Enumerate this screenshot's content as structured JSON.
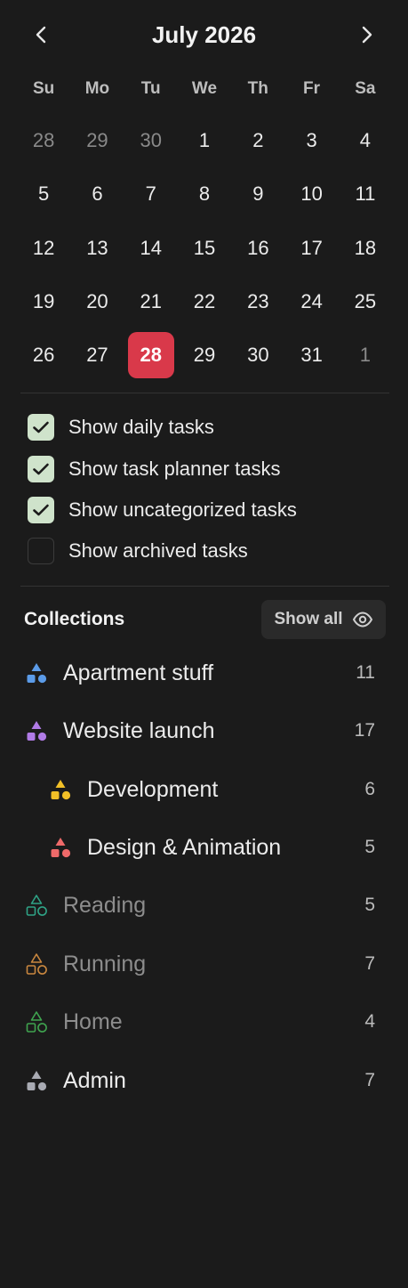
{
  "calendar": {
    "month_title": "July 2026",
    "weekdays": [
      "Su",
      "Mo",
      "Tu",
      "We",
      "Th",
      "Fr",
      "Sa"
    ],
    "weeks": [
      [
        "28",
        "29",
        "30",
        "1",
        "2",
        "3",
        "4"
      ],
      [
        "5",
        "6",
        "7",
        "8",
        "9",
        "10",
        "11"
      ],
      [
        "12",
        "13",
        "14",
        "15",
        "16",
        "17",
        "18"
      ],
      [
        "19",
        "20",
        "21",
        "22",
        "23",
        "24",
        "25"
      ],
      [
        "26",
        "27",
        "28",
        "29",
        "30",
        "31",
        "1"
      ]
    ],
    "today": "28",
    "accent_color": "#d9394a"
  },
  "options": [
    {
      "label": "Show daily tasks",
      "checked": true
    },
    {
      "label": "Show task planner tasks",
      "checked": true
    },
    {
      "label": "Show uncategorized tasks",
      "checked": true
    },
    {
      "label": "Show archived tasks",
      "checked": false
    }
  ],
  "collections": {
    "title": "Collections",
    "show_all_label": "Show all",
    "items": [
      {
        "name": "Apartment stuff",
        "count": "11",
        "color": "#5b9be8",
        "indent": false,
        "style": "filled"
      },
      {
        "name": "Website launch",
        "count": "17",
        "color": "#b07be6",
        "indent": false,
        "style": "filled"
      },
      {
        "name": "Development",
        "count": "6",
        "color": "#f2c027",
        "indent": true,
        "style": "filled"
      },
      {
        "name": "Design & Animation",
        "count": "5",
        "color": "#ef6a6a",
        "indent": true,
        "style": "filled"
      },
      {
        "name": "Reading",
        "count": "5",
        "color": "#2fa386",
        "indent": false,
        "style": "outline"
      },
      {
        "name": "Running",
        "count": "7",
        "color": "#c9873f",
        "indent": false,
        "style": "outline"
      },
      {
        "name": "Home",
        "count": "4",
        "color": "#3fa34f",
        "indent": false,
        "style": "outline"
      },
      {
        "name": "Admin",
        "count": "7",
        "color": "#a9abb3",
        "indent": false,
        "style": "filled"
      }
    ]
  }
}
